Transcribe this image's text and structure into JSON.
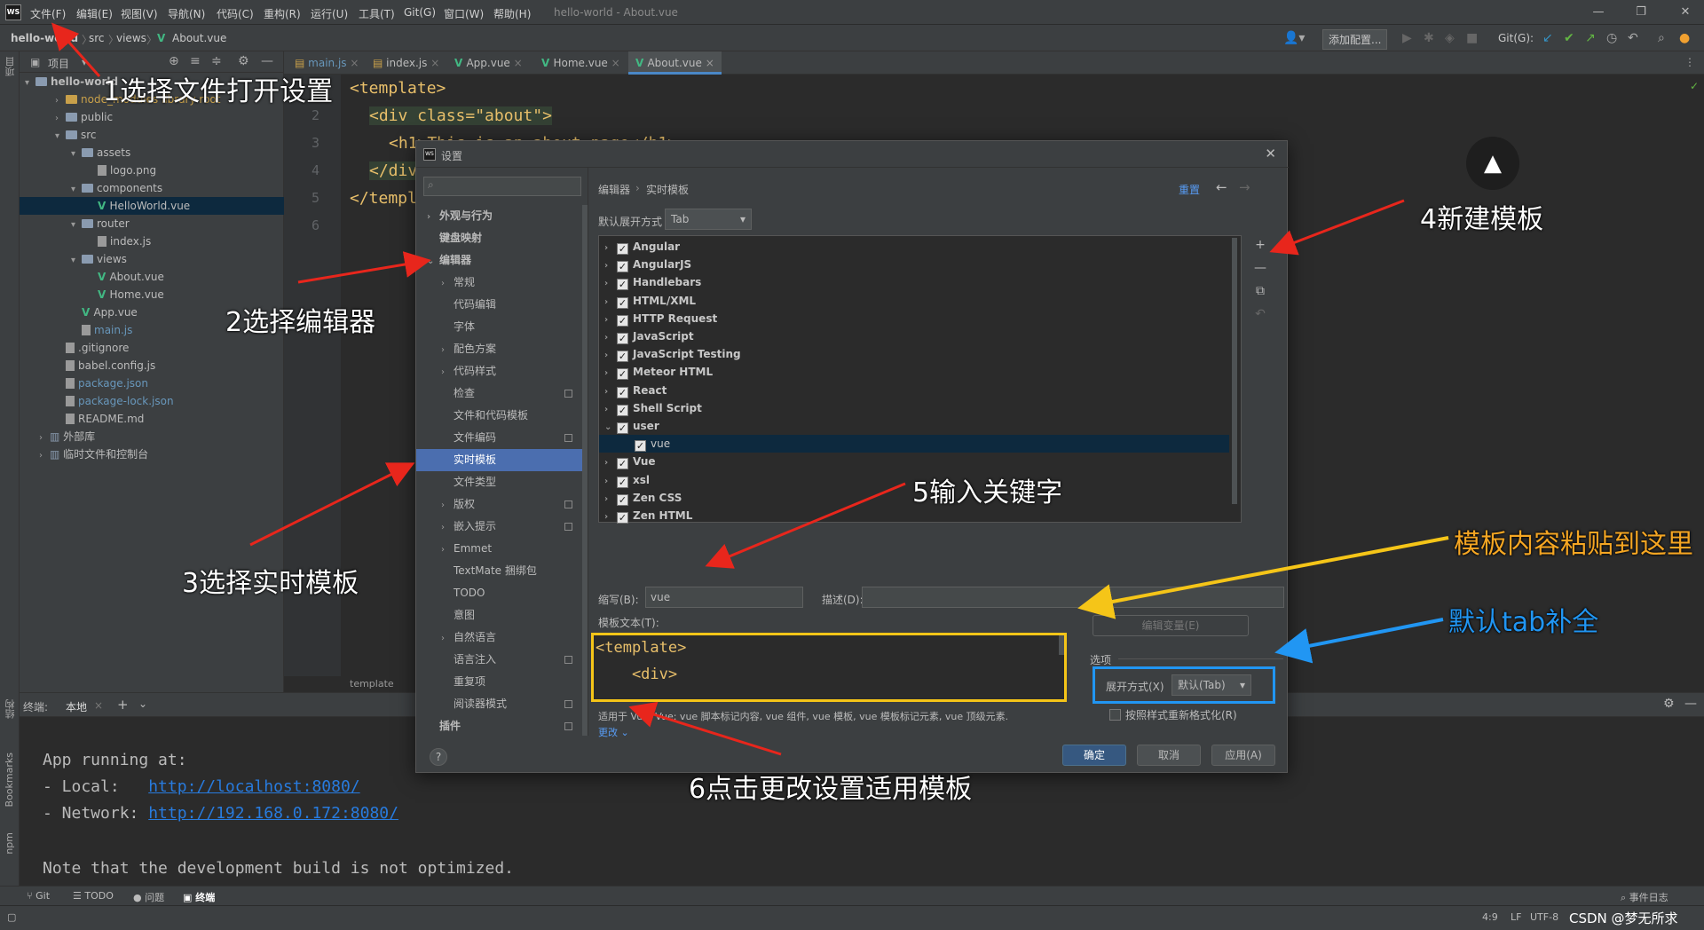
{
  "menu": {
    "items": [
      "文件(F)",
      "编辑(E)",
      "视图(V)",
      "导航(N)",
      "代码(C)",
      "重构(R)",
      "运行(U)",
      "工具(T)",
      "Git(G)",
      "窗口(W)",
      "帮助(H)"
    ],
    "window_title": "hello-world - About.vue"
  },
  "nav": {
    "crumbs": [
      "hello-world",
      "src",
      "views",
      "About.vue"
    ],
    "add_config": "添加配置...",
    "git_label": "Git(G):"
  },
  "project": {
    "header": "项目",
    "root": "hello-world",
    "items": [
      {
        "label": "node_modules  library root",
        "depth": 1,
        "kind": "folder"
      },
      {
        "label": "public",
        "depth": 1,
        "kind": "folder"
      },
      {
        "label": "src",
        "depth": 1,
        "kind": "folder"
      },
      {
        "label": "assets",
        "depth": 2,
        "kind": "folder"
      },
      {
        "label": "logo.png",
        "depth": 3,
        "kind": "file"
      },
      {
        "label": "components",
        "depth": 2,
        "kind": "folder"
      },
      {
        "label": "HelloWorld.vue",
        "depth": 3,
        "kind": "vue"
      },
      {
        "label": "router",
        "depth": 2,
        "kind": "folder"
      },
      {
        "label": "index.js",
        "depth": 3,
        "kind": "file"
      },
      {
        "label": "views",
        "depth": 2,
        "kind": "folder"
      },
      {
        "label": "About.vue",
        "depth": 3,
        "kind": "vue"
      },
      {
        "label": "Home.vue",
        "depth": 3,
        "kind": "vue"
      },
      {
        "label": "App.vue",
        "depth": 2,
        "kind": "vue"
      },
      {
        "label": "main.js",
        "depth": 2,
        "kind": "file"
      },
      {
        "label": ".gitignore",
        "depth": 1,
        "kind": "file"
      },
      {
        "label": "babel.config.js",
        "depth": 1,
        "kind": "file"
      },
      {
        "label": "package.json",
        "depth": 1,
        "kind": "file"
      },
      {
        "label": "package-lock.json",
        "depth": 1,
        "kind": "file"
      },
      {
        "label": "README.md",
        "depth": 1,
        "kind": "file"
      },
      {
        "label": "外部库",
        "depth": 0,
        "kind": "lib"
      },
      {
        "label": "临时文件和控制台",
        "depth": 0,
        "kind": "lib"
      }
    ]
  },
  "editor": {
    "tabs": [
      "main.js",
      "index.js",
      "App.vue",
      "Home.vue",
      "About.vue"
    ],
    "active_tab": "About.vue",
    "line_numbers": [
      "1",
      "2",
      "3",
      "4",
      "5",
      "6"
    ],
    "lines": [
      "<template>",
      "<div class=\"about\">",
      "<h1>This is an about page</h1>",
      "</div>",
      "</template>",
      ""
    ],
    "breadcrumb": "template"
  },
  "terminal": {
    "label": "终端:",
    "tab": "本地",
    "lines": [
      "App running at:",
      "- Local:   ",
      "- Network: ",
      "",
      "Note that the development build is not optimized."
    ],
    "local_url": "http://localhost:8080/",
    "network_url": "http://192.168.0.172:8080/"
  },
  "bottom_tabs": [
    "Git",
    "TODO",
    "问题",
    "终端"
  ],
  "event_log": "事件日志",
  "status": {
    "position": "4:9",
    "line_sep": "LF",
    "encoding": "UTF-8",
    "watermark": "CSDN @梦无所求"
  },
  "side_labels": {
    "project": "项目",
    "structure": "结构",
    "bookmarks": "Bookmarks",
    "npm": "npm"
  },
  "settings": {
    "title": "设置",
    "nav": [
      {
        "label": "外观与行为",
        "indent": 0,
        "chev": "right"
      },
      {
        "label": "键盘映射",
        "indent": 0,
        "chev": ""
      },
      {
        "label": "编辑器",
        "indent": 0,
        "chev": "down"
      },
      {
        "label": "常规",
        "indent": 1,
        "chev": "right"
      },
      {
        "label": "代码编辑",
        "indent": 1,
        "chev": ""
      },
      {
        "label": "字体",
        "indent": 1,
        "chev": ""
      },
      {
        "label": "配色方案",
        "indent": 1,
        "chev": "right"
      },
      {
        "label": "代码样式",
        "indent": 1,
        "chev": "right"
      },
      {
        "label": "检查",
        "indent": 1,
        "chev": ""
      },
      {
        "label": "文件和代码模板",
        "indent": 1,
        "chev": ""
      },
      {
        "label": "文件编码",
        "indent": 1,
        "chev": ""
      },
      {
        "label": "实时模板",
        "indent": 1,
        "chev": "",
        "selected": true
      },
      {
        "label": "文件类型",
        "indent": 1,
        "chev": ""
      },
      {
        "label": "版权",
        "indent": 1,
        "chev": "right"
      },
      {
        "label": "嵌入提示",
        "indent": 1,
        "chev": "right"
      },
      {
        "label": "Emmet",
        "indent": 1,
        "chev": "right"
      },
      {
        "label": "TextMate 捆绑包",
        "indent": 1,
        "chev": ""
      },
      {
        "label": "TODO",
        "indent": 1,
        "chev": ""
      },
      {
        "label": "意图",
        "indent": 1,
        "chev": ""
      },
      {
        "label": "自然语言",
        "indent": 1,
        "chev": "right"
      },
      {
        "label": "语言注入",
        "indent": 1,
        "chev": ""
      },
      {
        "label": "重复项",
        "indent": 1,
        "chev": ""
      },
      {
        "label": "阅读器模式",
        "indent": 1,
        "chev": ""
      },
      {
        "label": "插件",
        "indent": 0,
        "chev": ""
      }
    ],
    "breadcrumb": [
      "编辑器",
      "实时模板"
    ],
    "reset": "重置",
    "expand_label": "默认展开方式",
    "expand_value": "Tab",
    "groups": [
      {
        "name": "Angular",
        "expanded": false
      },
      {
        "name": "AngularJS",
        "expanded": false
      },
      {
        "name": "Handlebars",
        "expanded": false
      },
      {
        "name": "HTML/XML",
        "expanded": false
      },
      {
        "name": "HTTP Request",
        "expanded": false
      },
      {
        "name": "JavaScript",
        "expanded": false
      },
      {
        "name": "JavaScript Testing",
        "expanded": false
      },
      {
        "name": "Meteor HTML",
        "expanded": false
      },
      {
        "name": "React",
        "expanded": false
      },
      {
        "name": "Shell Script",
        "expanded": false
      },
      {
        "name": "user",
        "expanded": true
      },
      {
        "name": "vue",
        "child": true,
        "selected": true
      },
      {
        "name": "Vue",
        "expanded": false
      },
      {
        "name": "xsl",
        "expanded": false
      },
      {
        "name": "Zen CSS",
        "expanded": false
      },
      {
        "name": "Zen HTML",
        "expanded": false
      }
    ],
    "abbrev_label": "缩写(B):",
    "abbrev_value": "vue",
    "desc_label": "描述(D):",
    "desc_value": "",
    "template_text_label": "模板文本(T):",
    "template_text_lines": [
      "<template>",
      "    <div>"
    ],
    "edit_vars": "编辑变量(E)",
    "options_label": "选项",
    "expand_with_label": "展开方式(X)",
    "expand_with_value": "默认(Tab)",
    "reformat_label": "按照样式重新格式化(R)",
    "applicable": "适用于 Vue; Vue: vue 脚本标记内容, vue 组件, vue 模板, vue 模板标记元素, vue 顶级元素.",
    "change": "更改",
    "ok": "确定",
    "cancel": "取消",
    "apply": "应用(A)",
    "help": "?"
  },
  "annotations": {
    "step1": "1选择文件打开设置",
    "step2": "2选择编辑器",
    "step3": "3选择实时模板",
    "step4": "4新建模板",
    "step5": "5输入关键字",
    "step6": "6点击更改设置适用模板",
    "paste": "模板内容粘贴到这里",
    "tab_complete": "默认tab补全"
  },
  "colors": {
    "accent": "#4b6eaf",
    "arrow_red": "#e8261c",
    "arrow_orange": "#f5c518",
    "arrow_blue": "#2196f3",
    "vue_green": "#42b883"
  }
}
